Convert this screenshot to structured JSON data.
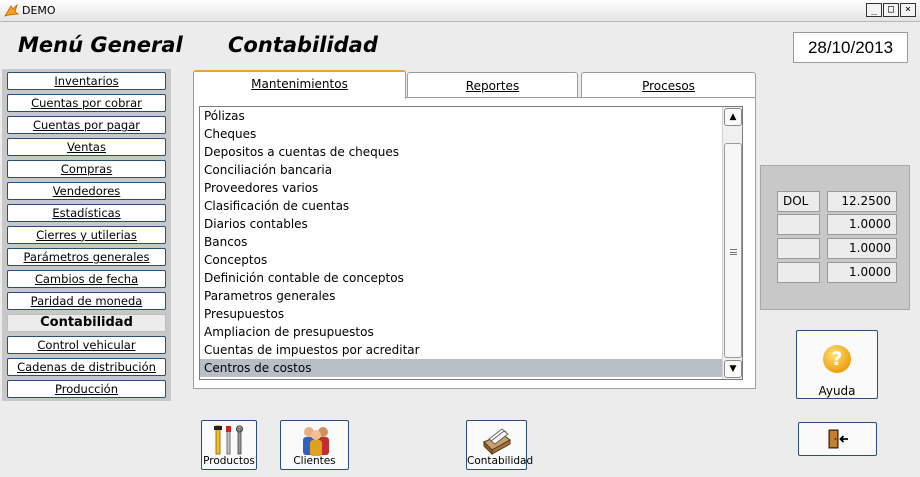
{
  "window": {
    "title": "DEMO",
    "controls": [
      "_",
      "□",
      "×"
    ]
  },
  "header": {
    "menu_title": "Menú General",
    "section_title": "Contabilidad",
    "date": "28/10/2013"
  },
  "sidebar": {
    "items": [
      {
        "label": "Inventarios"
      },
      {
        "label": "Cuentas por cobrar"
      },
      {
        "label": "Cuentas por pagar"
      },
      {
        "label": "Ventas"
      },
      {
        "label": "Compras"
      },
      {
        "label": "Vendedores"
      },
      {
        "label": "Estadísticas"
      },
      {
        "label": "Cierres y utilerias"
      },
      {
        "label": "Parámetros generales"
      },
      {
        "label": "Cambios de fecha"
      },
      {
        "label": "Paridad de moneda"
      },
      {
        "label": "Contabilidad",
        "active": true
      },
      {
        "label": "Control vehicular"
      },
      {
        "label": "Cadenas de distribución"
      },
      {
        "label": "Producción"
      }
    ]
  },
  "tabs": [
    {
      "label": "Mantenimientos",
      "active": true
    },
    {
      "label": "Reportes"
    },
    {
      "label": "Procesos"
    }
  ],
  "list": {
    "items": [
      "Pólizas",
      "Cheques",
      "Depositos a cuentas de cheques",
      "Conciliación bancaria",
      "Proveedores varios",
      "Clasificación de cuentas",
      "Diarios contables",
      "Bancos",
      "Conceptos",
      "Definición contable de conceptos",
      "Parametros generales",
      "Presupuestos",
      "Ampliacion de presupuestos",
      "Cuentas de impuestos por acreditar",
      "Centros de costos"
    ],
    "selected": "Centros de costos"
  },
  "rates": [
    {
      "code": "DOL",
      "value": "12.2500"
    },
    {
      "code": "",
      "value": "1.0000"
    },
    {
      "code": "",
      "value": "1.0000"
    },
    {
      "code": "",
      "value": "1.0000"
    }
  ],
  "help": {
    "label": "Ayuda",
    "icon": "question-icon"
  },
  "exit": {
    "icon": "exit-door-icon"
  },
  "bottom_buttons": [
    {
      "label": "Productos",
      "icon": "tools-icon"
    },
    {
      "label": "Clientes",
      "icon": "people-icon"
    },
    {
      "label": "Contabilidad",
      "icon": "card-file-icon"
    }
  ]
}
